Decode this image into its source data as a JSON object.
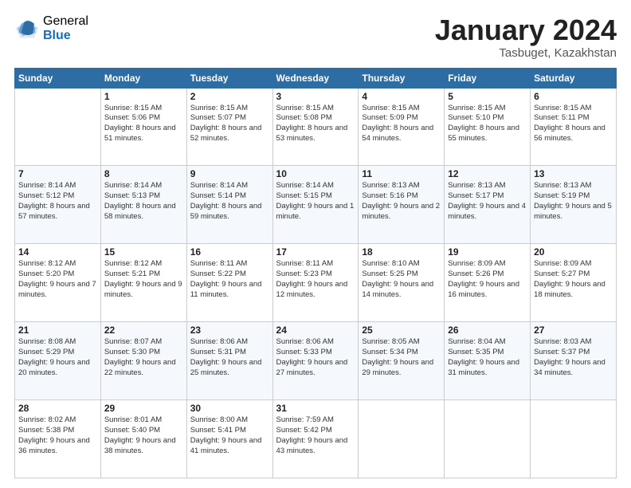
{
  "header": {
    "logo_general": "General",
    "logo_blue": "Blue",
    "title": "January 2024",
    "location": "Tasbuget, Kazakhstan"
  },
  "weekdays": [
    "Sunday",
    "Monday",
    "Tuesday",
    "Wednesday",
    "Thursday",
    "Friday",
    "Saturday"
  ],
  "weeks": [
    [
      {
        "day": "",
        "sunrise": "",
        "sunset": "",
        "daylight": ""
      },
      {
        "day": "1",
        "sunrise": "Sunrise: 8:15 AM",
        "sunset": "Sunset: 5:06 PM",
        "daylight": "Daylight: 8 hours and 51 minutes."
      },
      {
        "day": "2",
        "sunrise": "Sunrise: 8:15 AM",
        "sunset": "Sunset: 5:07 PM",
        "daylight": "Daylight: 8 hours and 52 minutes."
      },
      {
        "day": "3",
        "sunrise": "Sunrise: 8:15 AM",
        "sunset": "Sunset: 5:08 PM",
        "daylight": "Daylight: 8 hours and 53 minutes."
      },
      {
        "day": "4",
        "sunrise": "Sunrise: 8:15 AM",
        "sunset": "Sunset: 5:09 PM",
        "daylight": "Daylight: 8 hours and 54 minutes."
      },
      {
        "day": "5",
        "sunrise": "Sunrise: 8:15 AM",
        "sunset": "Sunset: 5:10 PM",
        "daylight": "Daylight: 8 hours and 55 minutes."
      },
      {
        "day": "6",
        "sunrise": "Sunrise: 8:15 AM",
        "sunset": "Sunset: 5:11 PM",
        "daylight": "Daylight: 8 hours and 56 minutes."
      }
    ],
    [
      {
        "day": "7",
        "sunrise": "Sunrise: 8:14 AM",
        "sunset": "Sunset: 5:12 PM",
        "daylight": "Daylight: 8 hours and 57 minutes."
      },
      {
        "day": "8",
        "sunrise": "Sunrise: 8:14 AM",
        "sunset": "Sunset: 5:13 PM",
        "daylight": "Daylight: 8 hours and 58 minutes."
      },
      {
        "day": "9",
        "sunrise": "Sunrise: 8:14 AM",
        "sunset": "Sunset: 5:14 PM",
        "daylight": "Daylight: 8 hours and 59 minutes."
      },
      {
        "day": "10",
        "sunrise": "Sunrise: 8:14 AM",
        "sunset": "Sunset: 5:15 PM",
        "daylight": "Daylight: 9 hours and 1 minute."
      },
      {
        "day": "11",
        "sunrise": "Sunrise: 8:13 AM",
        "sunset": "Sunset: 5:16 PM",
        "daylight": "Daylight: 9 hours and 2 minutes."
      },
      {
        "day": "12",
        "sunrise": "Sunrise: 8:13 AM",
        "sunset": "Sunset: 5:17 PM",
        "daylight": "Daylight: 9 hours and 4 minutes."
      },
      {
        "day": "13",
        "sunrise": "Sunrise: 8:13 AM",
        "sunset": "Sunset: 5:19 PM",
        "daylight": "Daylight: 9 hours and 5 minutes."
      }
    ],
    [
      {
        "day": "14",
        "sunrise": "Sunrise: 8:12 AM",
        "sunset": "Sunset: 5:20 PM",
        "daylight": "Daylight: 9 hours and 7 minutes."
      },
      {
        "day": "15",
        "sunrise": "Sunrise: 8:12 AM",
        "sunset": "Sunset: 5:21 PM",
        "daylight": "Daylight: 9 hours and 9 minutes."
      },
      {
        "day": "16",
        "sunrise": "Sunrise: 8:11 AM",
        "sunset": "Sunset: 5:22 PM",
        "daylight": "Daylight: 9 hours and 11 minutes."
      },
      {
        "day": "17",
        "sunrise": "Sunrise: 8:11 AM",
        "sunset": "Sunset: 5:23 PM",
        "daylight": "Daylight: 9 hours and 12 minutes."
      },
      {
        "day": "18",
        "sunrise": "Sunrise: 8:10 AM",
        "sunset": "Sunset: 5:25 PM",
        "daylight": "Daylight: 9 hours and 14 minutes."
      },
      {
        "day": "19",
        "sunrise": "Sunrise: 8:09 AM",
        "sunset": "Sunset: 5:26 PM",
        "daylight": "Daylight: 9 hours and 16 minutes."
      },
      {
        "day": "20",
        "sunrise": "Sunrise: 8:09 AM",
        "sunset": "Sunset: 5:27 PM",
        "daylight": "Daylight: 9 hours and 18 minutes."
      }
    ],
    [
      {
        "day": "21",
        "sunrise": "Sunrise: 8:08 AM",
        "sunset": "Sunset: 5:29 PM",
        "daylight": "Daylight: 9 hours and 20 minutes."
      },
      {
        "day": "22",
        "sunrise": "Sunrise: 8:07 AM",
        "sunset": "Sunset: 5:30 PM",
        "daylight": "Daylight: 9 hours and 22 minutes."
      },
      {
        "day": "23",
        "sunrise": "Sunrise: 8:06 AM",
        "sunset": "Sunset: 5:31 PM",
        "daylight": "Daylight: 9 hours and 25 minutes."
      },
      {
        "day": "24",
        "sunrise": "Sunrise: 8:06 AM",
        "sunset": "Sunset: 5:33 PM",
        "daylight": "Daylight: 9 hours and 27 minutes."
      },
      {
        "day": "25",
        "sunrise": "Sunrise: 8:05 AM",
        "sunset": "Sunset: 5:34 PM",
        "daylight": "Daylight: 9 hours and 29 minutes."
      },
      {
        "day": "26",
        "sunrise": "Sunrise: 8:04 AM",
        "sunset": "Sunset: 5:35 PM",
        "daylight": "Daylight: 9 hours and 31 minutes."
      },
      {
        "day": "27",
        "sunrise": "Sunrise: 8:03 AM",
        "sunset": "Sunset: 5:37 PM",
        "daylight": "Daylight: 9 hours and 34 minutes."
      }
    ],
    [
      {
        "day": "28",
        "sunrise": "Sunrise: 8:02 AM",
        "sunset": "Sunset: 5:38 PM",
        "daylight": "Daylight: 9 hours and 36 minutes."
      },
      {
        "day": "29",
        "sunrise": "Sunrise: 8:01 AM",
        "sunset": "Sunset: 5:40 PM",
        "daylight": "Daylight: 9 hours and 38 minutes."
      },
      {
        "day": "30",
        "sunrise": "Sunrise: 8:00 AM",
        "sunset": "Sunset: 5:41 PM",
        "daylight": "Daylight: 9 hours and 41 minutes."
      },
      {
        "day": "31",
        "sunrise": "Sunrise: 7:59 AM",
        "sunset": "Sunset: 5:42 PM",
        "daylight": "Daylight: 9 hours and 43 minutes."
      },
      {
        "day": "",
        "sunrise": "",
        "sunset": "",
        "daylight": ""
      },
      {
        "day": "",
        "sunrise": "",
        "sunset": "",
        "daylight": ""
      },
      {
        "day": "",
        "sunrise": "",
        "sunset": "",
        "daylight": ""
      }
    ]
  ]
}
